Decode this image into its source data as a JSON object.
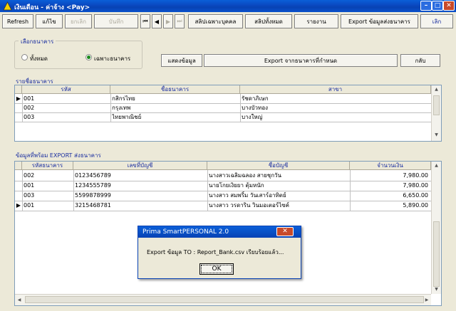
{
  "window": {
    "title": "เงินเดือน - ค่าจ้าง <Pay>",
    "min": "–",
    "max": "□",
    "close": "✕"
  },
  "toolbar": {
    "refresh": "Refresh",
    "edit": "แก้ไข",
    "cancel": "ยกเลิก",
    "save": "บันทึก",
    "nav_first": "⏮",
    "nav_prev": "◀",
    "nav_next": "▶",
    "nav_last": "⏭",
    "slip_person": "สลิปเฉพาะบุคคล",
    "slip_all": "สลิปทั้งหมด",
    "report": "รายงาน",
    "export_bank": "Export ข้อมูลส่งธนาคาร",
    "exit": "เลิก"
  },
  "bank_select": {
    "title": "เลือกธนาคาร",
    "opt_all": "ทั้งหมด",
    "opt_selected": "เฉพาะธนาคาร",
    "selected": "opt_selected"
  },
  "actions": {
    "show_data": "แสดงข้อมูล",
    "export_to_bank": "Export จากธนาคารที่กำหนด",
    "back": "กลับ"
  },
  "banks": {
    "label": "รายชื่อธนาคาร",
    "headers": [
      "รหัส",
      "ชื่อธนาคาร",
      "สาขา"
    ],
    "rows": [
      {
        "code": "001",
        "name": "กสิกรไทย",
        "branch": "รัชดาภิเษก"
      },
      {
        "code": "002",
        "name": "กรุงเทพ",
        "branch": "บางบัวทอง"
      },
      {
        "code": "003",
        "name": "ไทยพาณิชย์",
        "branch": "บางใหญ่"
      }
    ]
  },
  "export": {
    "label": "ข้อมูลที่พร้อม EXPORT ส่งธนาคาร",
    "headers": [
      "รหัสธนาคาร",
      "เลขที่บัญชี",
      "ชื่อบัญชี",
      "จำนวนเงิน"
    ],
    "rows": [
      {
        "bank": "002",
        "account": "0123456789",
        "name": "นางสาวเฉลิมฉลอง สายชุกวัน",
        "amount": "7,980.00"
      },
      {
        "bank": "001",
        "account": "1234555789",
        "name": "นายโกยเงิยยา ตุ้มหนัก",
        "amount": "7,980.00"
      },
      {
        "bank": "003",
        "account": "5599878999",
        "name": "นางสาว สมพริ้ม วันเสาร์อาทิตย์",
        "amount": "6,650.00"
      },
      {
        "bank": "001",
        "account": "3215468781",
        "name": "นางสาว วรดาริน วินมอเตอร์ไซค์",
        "amount": "5,890.00"
      }
    ]
  },
  "dialog": {
    "title": "Prima SmartPERSONAL 2.0",
    "message": "Export ข้อมูล TO : Report_Bank.csv เรียบร้อยแล้ว...",
    "ok": "OK"
  }
}
